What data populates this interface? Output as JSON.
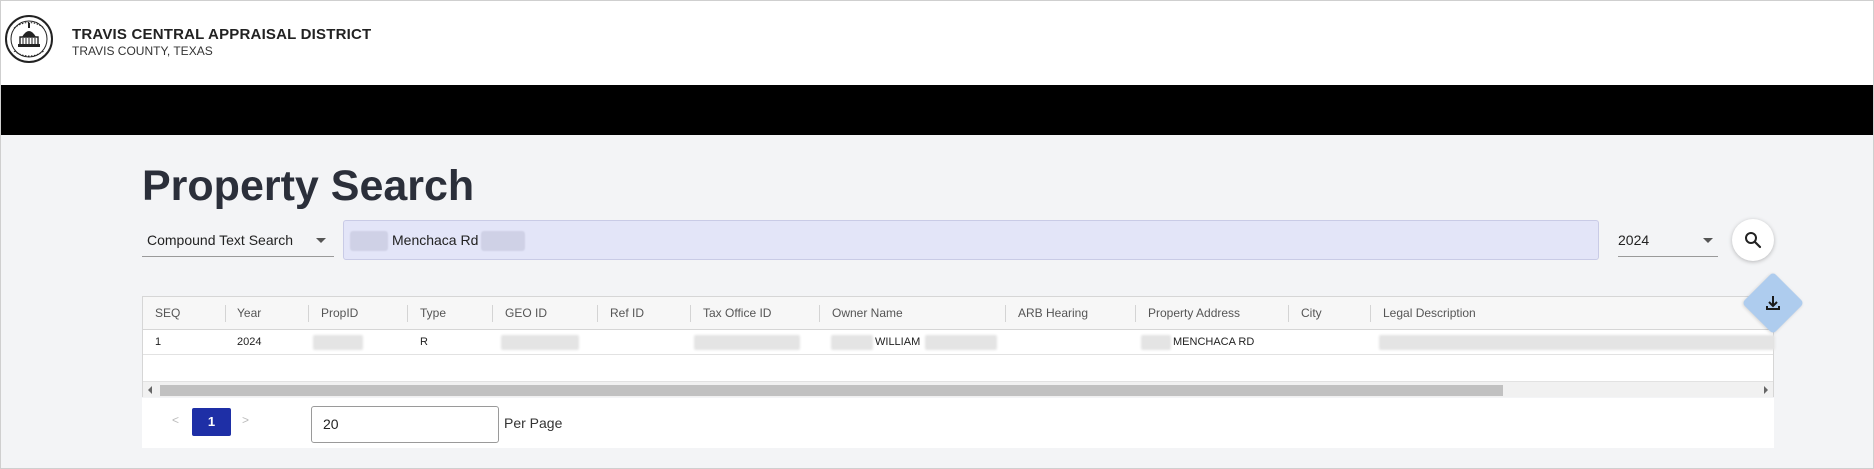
{
  "header": {
    "org_title": "TRAVIS CENTRAL APPRAISAL DISTRICT",
    "org_subtitle": "TRAVIS COUNTY, TEXAS"
  },
  "page": {
    "title": "Property Search"
  },
  "search": {
    "type_selected": "Compound Text Search",
    "query_value": "Menchaca Rd",
    "year_selected": "2024"
  },
  "table": {
    "columns": [
      "SEQ",
      "Year",
      "PropID",
      "Type",
      "GEO ID",
      "Ref ID",
      "Tax Office ID",
      "Owner Name",
      "ARB Hearing",
      "Property Address",
      "City",
      "Legal Description"
    ],
    "rows": [
      {
        "seq": "1",
        "year": "2024",
        "prop_id": "",
        "type": "R",
        "geo_id": "",
        "ref_id": "",
        "tax_office_id": "",
        "owner_name": "WILLIAM",
        "arb_hearing": "",
        "property_address": "MENCHACA RD",
        "city": "",
        "legal_description": ""
      }
    ]
  },
  "pagination": {
    "prev": "<",
    "current_page": "1",
    "next": ">",
    "per_page_value": "20",
    "per_page_label": "Per Page"
  },
  "colors": {
    "accent": "#1e2fa6",
    "search_bg": "#e3e5f8",
    "download_bg": "#aeccee",
    "topbar": "#000000"
  },
  "icons": {
    "logo": "county-seal-icon",
    "search": "search-icon",
    "download": "download-icon"
  }
}
